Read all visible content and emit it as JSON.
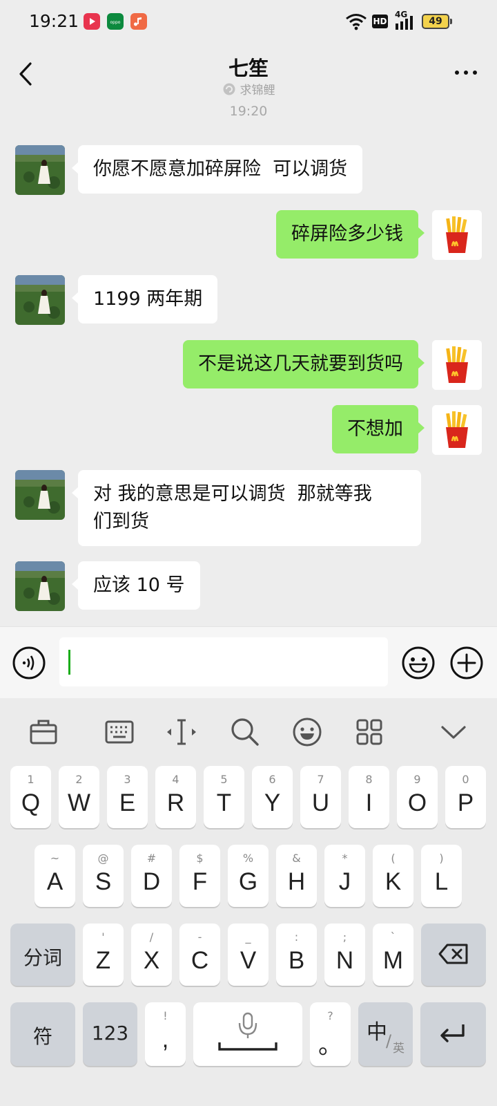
{
  "status_bar": {
    "time": "19:21",
    "app_icons": [
      "video-app-icon",
      "oppo-app-icon",
      "music-app-icon"
    ],
    "icons": [
      "wifi-icon",
      "hd-icon",
      "signal-4g-icon",
      "battery-icon"
    ],
    "hd_label": "HD",
    "network_label": "4G",
    "battery": "49"
  },
  "header": {
    "title": "七笙",
    "subtitle": "求锦鲤"
  },
  "chat": {
    "time_divider": "19:20",
    "messages": [
      {
        "side": "in",
        "text": "你愿不愿意加碎屏险  可以调货"
      },
      {
        "side": "out",
        "text": "碎屏险多少钱"
      },
      {
        "side": "in",
        "text": "1199 两年期"
      },
      {
        "side": "out",
        "text": "不是说这几天就要到货吗"
      },
      {
        "side": "out",
        "text": "不想加"
      },
      {
        "side": "in",
        "text": "对 我的意思是可以调货  那就等我\n们到货"
      },
      {
        "side": "in",
        "text": "应该 10 号"
      }
    ]
  },
  "input": {
    "value": "",
    "placeholder": ""
  },
  "keyboard": {
    "toolbar": [
      "clipboard-icon",
      "keyboard-icon",
      "cursor-icon",
      "search-icon",
      "emoji-icon",
      "apps-grid-icon",
      "collapse-chevron-icon"
    ],
    "row1": [
      {
        "main": "Q",
        "sub": "1"
      },
      {
        "main": "W",
        "sub": "2"
      },
      {
        "main": "E",
        "sub": "3"
      },
      {
        "main": "R",
        "sub": "4"
      },
      {
        "main": "T",
        "sub": "5"
      },
      {
        "main": "Y",
        "sub": "6"
      },
      {
        "main": "U",
        "sub": "7"
      },
      {
        "main": "I",
        "sub": "8"
      },
      {
        "main": "O",
        "sub": "9"
      },
      {
        "main": "P",
        "sub": "0"
      }
    ],
    "row2": [
      {
        "main": "A",
        "sub": "~"
      },
      {
        "main": "S",
        "sub": "@"
      },
      {
        "main": "D",
        "sub": "#"
      },
      {
        "main": "F",
        "sub": "$"
      },
      {
        "main": "G",
        "sub": "%"
      },
      {
        "main": "H",
        "sub": "&"
      },
      {
        "main": "J",
        "sub": "*"
      },
      {
        "main": "K",
        "sub": "("
      },
      {
        "main": "L",
        "sub": ")"
      }
    ],
    "row3": [
      {
        "main": "Z",
        "sub": "'"
      },
      {
        "main": "X",
        "sub": "/"
      },
      {
        "main": "C",
        "sub": "-"
      },
      {
        "main": "V",
        "sub": "_"
      },
      {
        "main": "B",
        "sub": ":"
      },
      {
        "main": "N",
        "sub": ";"
      },
      {
        "main": "M",
        "sub": "`"
      }
    ],
    "segment_key": "分词",
    "symbol_key": "符",
    "numeric_key": "123",
    "comma_key": {
      "main": ",",
      "sub": "!"
    },
    "period_key": {
      "main": "。",
      "sub": "?"
    },
    "lang_key": {
      "main": "中",
      "alt": "英"
    }
  }
}
